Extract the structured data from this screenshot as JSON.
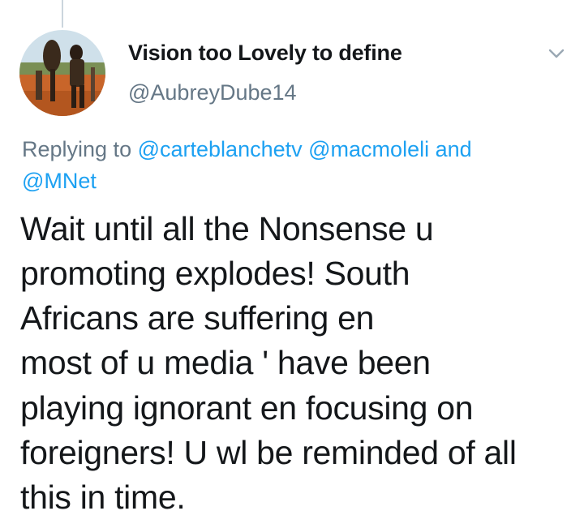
{
  "user": {
    "display_name": "Vision too Lovely to define",
    "handle": "@AubreyDube14"
  },
  "reply": {
    "prefix": "Replying to",
    "mention_1": "@carteblanchetv",
    "mention_2": "@macmoleli",
    "conjunction": "and",
    "mention_3": "@MNet"
  },
  "tweet": {
    "lines": [
      "Wait until all the Nonsense u",
      "promoting explodes! South",
      "Africans are suffering en",
      "most of u media ' have been",
      "playing ignorant en focusing on",
      "foreigners! U wl be reminded of all",
      "this in time."
    ]
  },
  "icons": {
    "menu": "chevron-down-icon",
    "avatar": "avatar-photo"
  },
  "colors": {
    "text": "#14171a",
    "secondary": "#657786",
    "link": "#1da1f2",
    "thread_line": "#cbd5dd"
  }
}
